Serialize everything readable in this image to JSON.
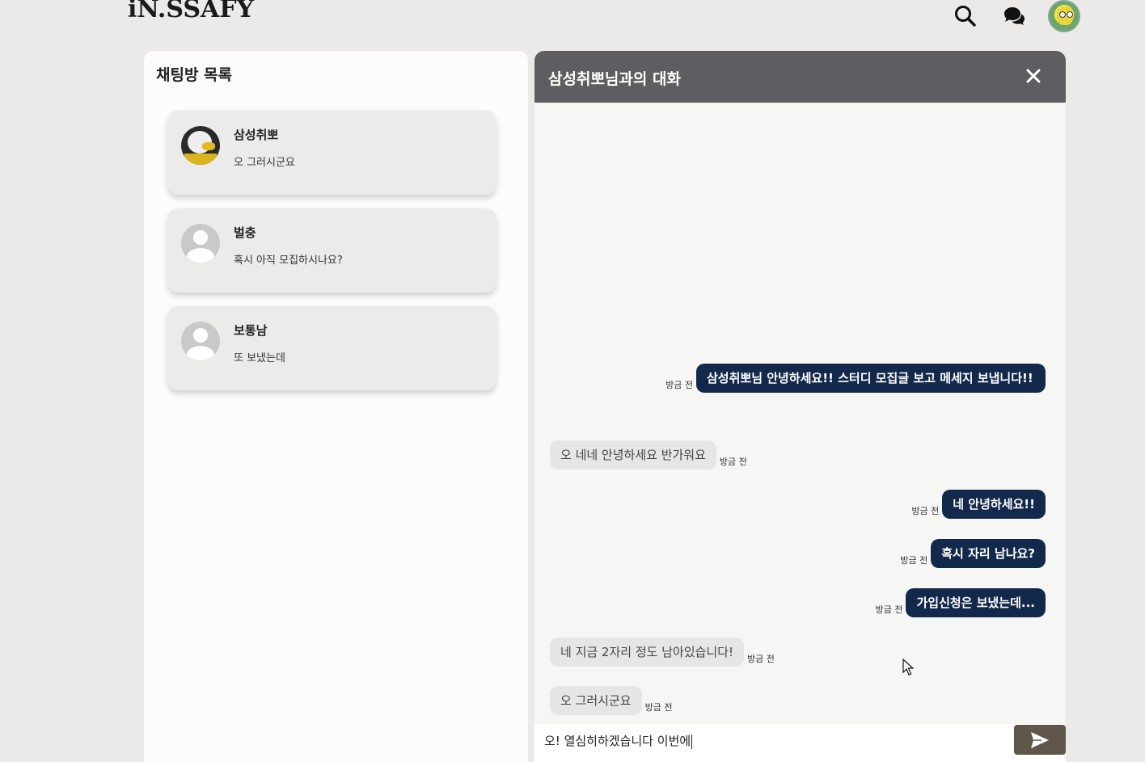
{
  "header": {
    "logo": "iN.SSAFY",
    "icons": [
      "search-icon",
      "chat-icon",
      "profile-avatar"
    ]
  },
  "rooms_panel": {
    "title": "채팅방 목록",
    "rooms": [
      {
        "name": "삼성취뽀",
        "last_message": "오 그러시군요",
        "avatar": "photo"
      },
      {
        "name": "벌충",
        "last_message": "혹시 아직 모집하시나요?",
        "avatar": "default"
      },
      {
        "name": "보통남",
        "last_message": "또 보냈는데",
        "avatar": "default"
      }
    ]
  },
  "chat": {
    "title": "삼성취뽀님과의 대화",
    "messages": [
      {
        "from": "me",
        "text": "삼성취뽀님 안녕하세요!! 스터디 모집글 보고 메세지 보냅니다!!",
        "time": "방금 전"
      },
      {
        "from": "them",
        "text": "오 네네 안녕하세요 반가워요",
        "time": "방금 전"
      },
      {
        "from": "me",
        "text": "네 안녕하세요!!",
        "time": "방금 전"
      },
      {
        "from": "me",
        "text": "혹시 자리 남나요?",
        "time": "방금 전"
      },
      {
        "from": "me",
        "text": "가입신청은 보냈는데...",
        "time": "방금 전"
      },
      {
        "from": "them",
        "text": "네 지금 2자리 정도 남아있습니다!",
        "time": "방금 전"
      },
      {
        "from": "them",
        "text": "오 그러시군요",
        "time": "방금 전"
      }
    ],
    "input_value": "오! 열심히하겠습니다 이번에"
  },
  "colors": {
    "background": "#ebeae8",
    "header_bar": "#5e5e62",
    "my_bubble": "#13294b",
    "their_bubble": "#e6e6e5",
    "send_button": "#5f574a"
  }
}
